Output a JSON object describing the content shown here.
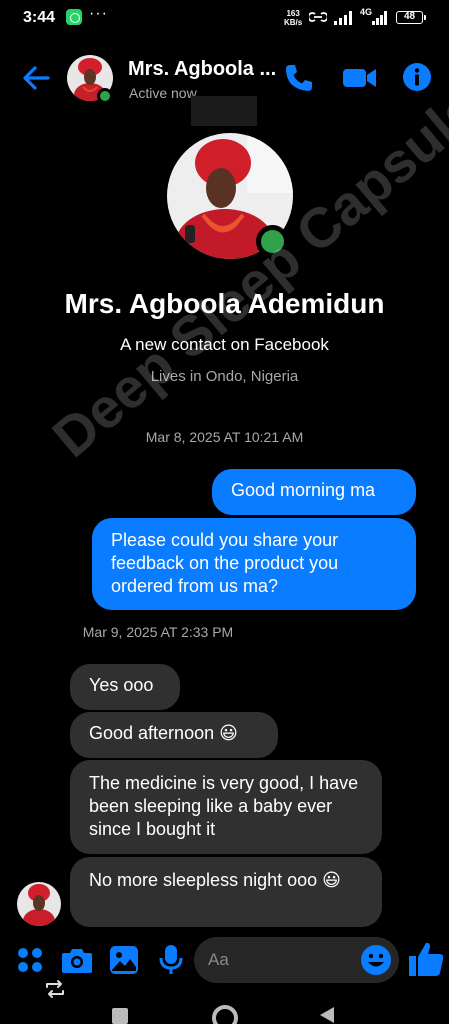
{
  "status_bar": {
    "time": "3:44",
    "dots": "···",
    "net_speed_value": "163",
    "net_speed_unit": "KB/s",
    "lte": "4G",
    "battery": "48"
  },
  "header": {
    "contact_name": "Mrs. Agboola ...",
    "presence": "Active now"
  },
  "profile": {
    "name": "Mrs. Agboola Ademidun",
    "subtitle": "A new contact on Facebook",
    "location": "Lives in Ondo, Nigeria"
  },
  "conversation": {
    "timestamp_1": "Mar 8, 2025 AT 10:21 AM",
    "outgoing": [
      {
        "text": "Good morning ma"
      },
      {
        "text": "Please could you share your feedback on the product you ordered from us ma?"
      }
    ],
    "timestamp_2": "Mar 9, 2025 AT 2:33 PM",
    "incoming": [
      {
        "text": "Yes ooo"
      },
      {
        "text": "Good afternoon 😃"
      },
      {
        "text": "The medicine is very good, I have been sleeping like a baby ever since I bought it"
      },
      {
        "text": "No more sleepless night ooo 😃"
      }
    ]
  },
  "composer": {
    "placeholder": "Aa"
  },
  "watermark": "Deep Sleep Capsule",
  "colors": {
    "accent": "#0a7cff",
    "online": "#31a24c",
    "incoming_bubble": "#303030"
  }
}
